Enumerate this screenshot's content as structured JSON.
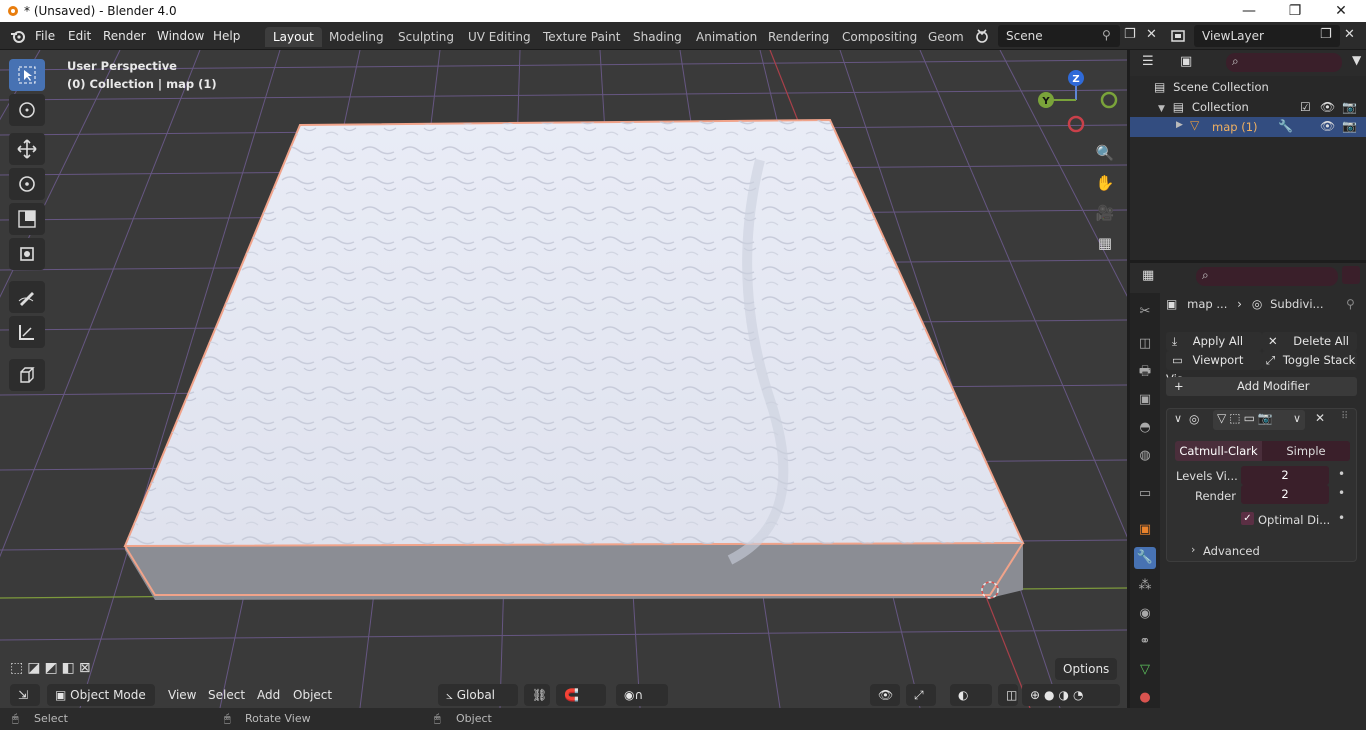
{
  "window": {
    "title": "* (Unsaved) - Blender 4.0",
    "minimize": "—",
    "maximize": "❐",
    "close": "✕"
  },
  "menus": [
    "File",
    "Edit",
    "Render",
    "Window",
    "Help"
  ],
  "workspaces": [
    "Layout",
    "Modeling",
    "Sculpting",
    "UV Editing",
    "Texture Paint",
    "Shading",
    "Animation",
    "Rendering",
    "Compositing",
    "Geome"
  ],
  "active_workspace": "Layout",
  "scene": {
    "label": "Scene"
  },
  "view_layer": {
    "label": "ViewLayer"
  },
  "viewport": {
    "perspective": "User Perspective",
    "collection_info": "(0) Collection | map (1)",
    "gizmo_axes": {
      "z": "Z",
      "y": "Y"
    },
    "options_label": "Options"
  },
  "viewport_header": {
    "mode": "Object Mode",
    "menus": [
      "View",
      "Select",
      "Add",
      "Object"
    ],
    "transform_orientation": "Global"
  },
  "statusbar": {
    "left": "Select",
    "middle": "Rotate View",
    "right": "Object"
  },
  "outliner": {
    "scene_collection": "Scene Collection",
    "collection": "Collection",
    "object": "map (1)"
  },
  "properties": {
    "breadcrumb_object": "map ...",
    "breadcrumb_modifier": "Subdivi...",
    "apply_all": "Apply All",
    "delete_all": "Delete All",
    "viewport_vis": "Viewport Vis",
    "toggle_stack": "Toggle Stack",
    "add_modifier": "Add Modifier",
    "modifier": {
      "tab_catmull": "Catmull-Clark",
      "tab_simple": "Simple",
      "levels_label": "Levels Vi...",
      "levels_value": "2",
      "render_label": "Render",
      "render_value": "2",
      "optimal_label": "Optimal Di...",
      "advanced_label": "Advanced"
    }
  },
  "colors": {
    "accent": "#4772b3",
    "selection_outline": "#f0a38a",
    "grid": "#6b5a8a"
  }
}
